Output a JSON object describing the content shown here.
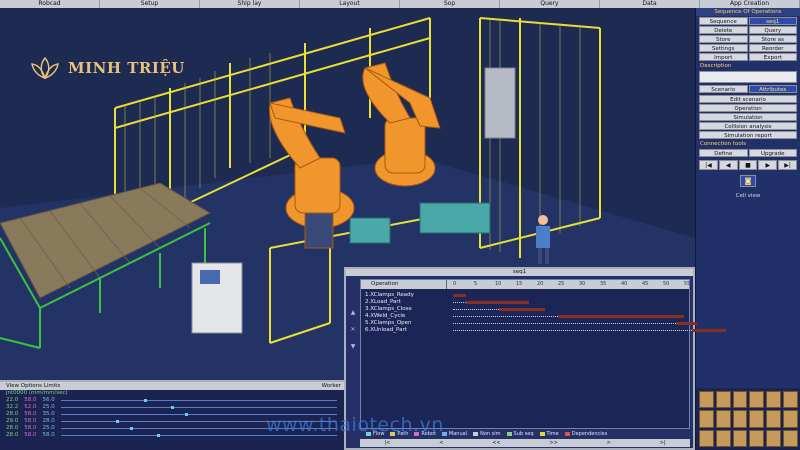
{
  "menu": [
    "Robcad",
    "Setup",
    "Ship lay",
    "Layout",
    "Sop",
    "Query",
    "Data",
    "App Creation"
  ],
  "brand": {
    "name": "MINH TRIỆU"
  },
  "watermark": "www.thaiotech.vn",
  "right_panel": {
    "title": "Sequence Of Operations",
    "buttons_top": [
      "Sequence",
      "Delete",
      "Store",
      "Settings",
      "Import",
      "seq1",
      "Query",
      "Store as",
      "Reorder",
      "Export"
    ],
    "description_label": "Description",
    "scenario": "Scenario",
    "attributes": "Attributes",
    "edit_scenario": "Edit scenario",
    "mid_buttons": [
      "Operation",
      "Simulation",
      "Collision analysis",
      "Simulation report"
    ],
    "connection_label": "Connection tools",
    "define": "Define",
    "upgrade": "Upgrade",
    "vcr": [
      "|◀",
      "◀",
      "■",
      "▶",
      "▶|"
    ],
    "camera_icon": "camera-icon",
    "cell_view": "Cell view"
  },
  "status": {
    "menu": "View Options Limits",
    "worker": "Worker",
    "header_row": "jnt0000 (mm/mm/sec)",
    "rows": [
      {
        "a": "22.0",
        "b": "58.0",
        "c": "56.0"
      },
      {
        "a": "32.2",
        "b": "52.0",
        "c": "25.0"
      },
      {
        "a": "28.0",
        "b": "58.0",
        "c": "35.0"
      },
      {
        "a": "29.0",
        "b": "58.0",
        "c": "28.0"
      },
      {
        "a": "28.0",
        "b": "58.0",
        "c": "25.0"
      },
      {
        "a": "28.0",
        "b": "58.0",
        "c": "58.0"
      }
    ]
  },
  "gantt": {
    "title": "seq1",
    "col_header": "Operation",
    "timeline": [
      "0",
      "5",
      "10",
      "15",
      "20",
      "25",
      "30",
      "35",
      "40",
      "45",
      "50",
      "55"
    ],
    "operations": [
      "1.XClamps_Ready",
      "2.XLoad_Part",
      "3.XClamps_Close",
      "4.XWeld_Cycle",
      "5.XClamps_Open",
      "6.XUnload_Part"
    ],
    "bars": [
      {
        "start": 0,
        "end": 3
      },
      {
        "start": 3,
        "end": 18
      },
      {
        "start": 11,
        "end": 22
      },
      {
        "start": 25,
        "end": 55
      },
      {
        "start": 53,
        "end": 58
      },
      {
        "start": 57,
        "end": 65
      }
    ],
    "legend": [
      {
        "label": "Flow",
        "color": "#7cd0d0"
      },
      {
        "label": "Path",
        "color": "#d0d05c"
      },
      {
        "label": "Robot",
        "color": "#d06cd0"
      },
      {
        "label": "Manual",
        "color": "#6cb4e8"
      },
      {
        "label": "Non sim",
        "color": "#cccccc"
      },
      {
        "label": "Sub seq",
        "color": "#8ad08a"
      },
      {
        "label": "Time",
        "color": "#e8d040"
      },
      {
        "label": "Dependencies",
        "color": "#e05050"
      }
    ],
    "nav": [
      "|<",
      "<",
      "<<",
      ">>",
      ">",
      ">|"
    ]
  }
}
